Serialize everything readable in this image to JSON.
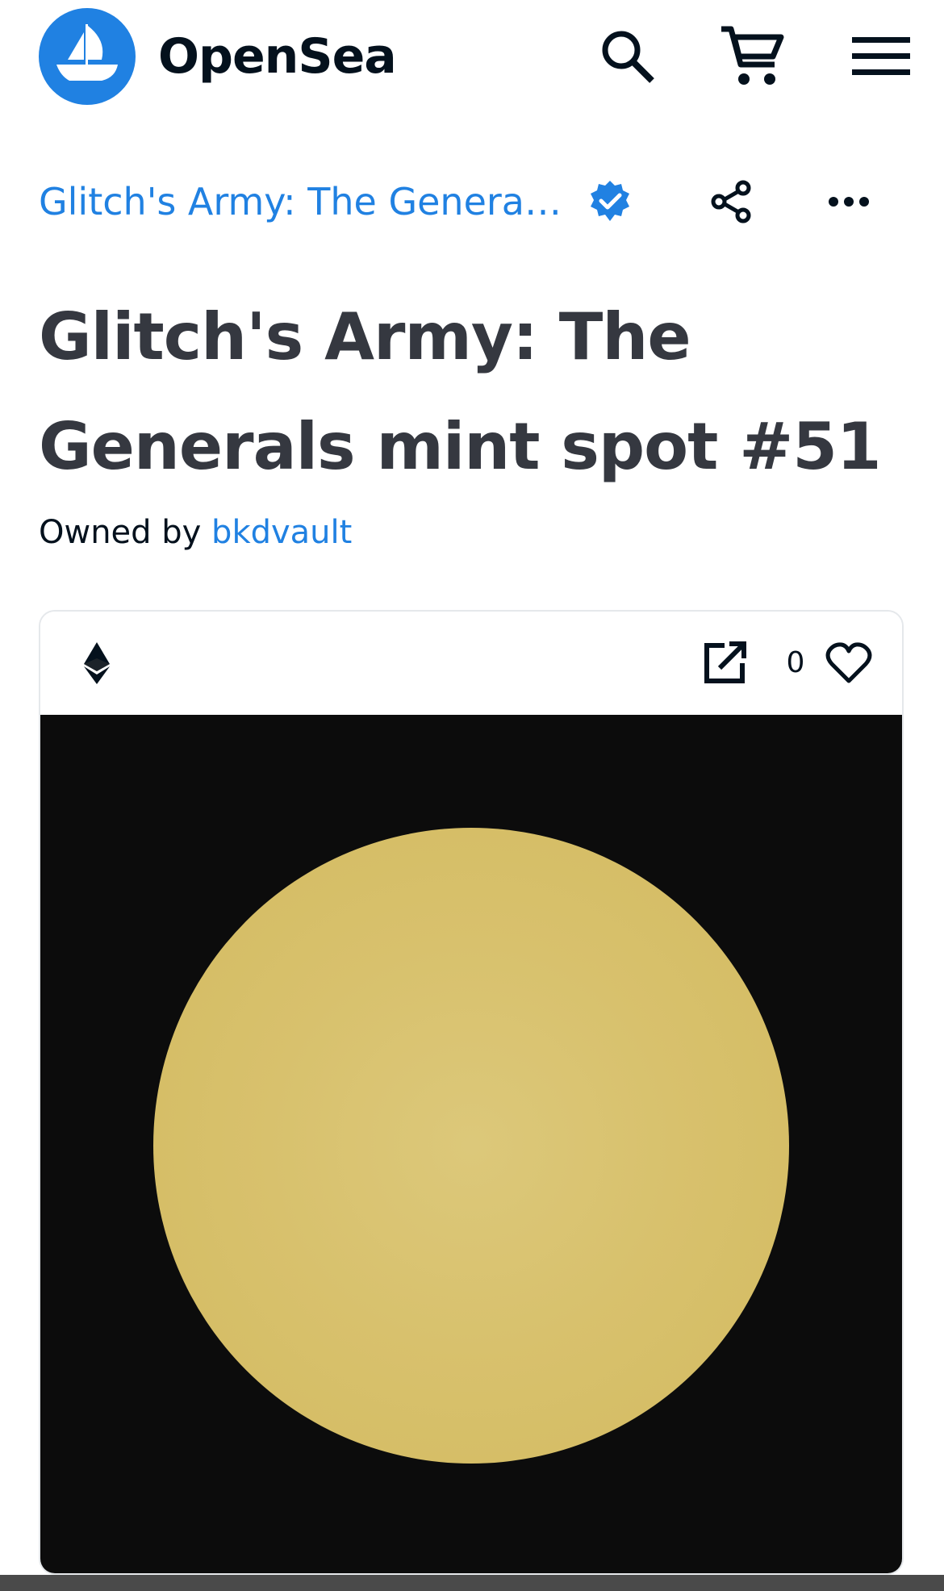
{
  "nav": {
    "brand": "OpenSea",
    "icons": {
      "logo": "opensea-ship-logo",
      "search": "search-icon",
      "cart": "cart-icon",
      "menu": "hamburger-menu-icon"
    },
    "colors": {
      "brand_blue": "#2081e2",
      "brand_text": "#04111d"
    }
  },
  "collection": {
    "name": "Glitch's Army: The General...",
    "verified_icon": "verified-badge-icon",
    "share_icon": "share-icon",
    "more_icon": "more-options-icon"
  },
  "asset": {
    "title": "Glitch's Army: The Generals mint spot #51",
    "owner_prefix": "Owned by",
    "owner_name": "bkdvault"
  },
  "card": {
    "chain_icon": "ethereum-icon",
    "external_icon": "external-link-icon",
    "favorite_count": "0",
    "favorite_icon": "heart-icon",
    "media_background": "#0c0c0c",
    "coin_color": "#d8c16d"
  }
}
